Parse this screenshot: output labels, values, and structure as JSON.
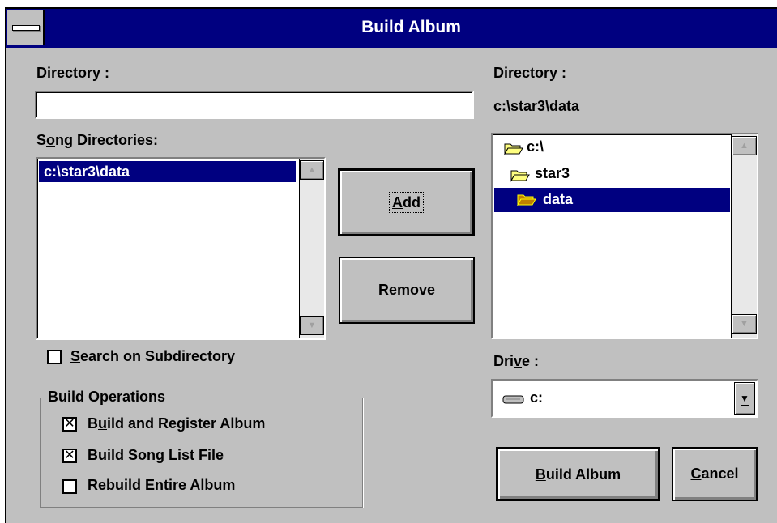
{
  "window": {
    "title": "Build Album"
  },
  "left": {
    "directory_label_pre": "D",
    "directory_label_u": "i",
    "directory_label_post": "rectory  :",
    "directory_value": "",
    "song_dirs_label_pre": "S",
    "song_dirs_label_u": "o",
    "song_dirs_label_post": "ng Directories:",
    "song_dirs": [
      "c:\\star3\\data"
    ],
    "search_sub_u": "S",
    "search_sub_post": "earch on Subdirectory",
    "search_sub_checked": false
  },
  "buttons": {
    "add_u": "A",
    "add_post": "dd",
    "remove_u": "R",
    "remove_post": "emove",
    "build_u": "B",
    "build_post": "uild Album",
    "cancel_u": "C",
    "cancel_post": "ancel"
  },
  "build_ops": {
    "title": "Build Operations",
    "items": [
      {
        "pre": "B",
        "u": "u",
        "post": "ild and Register Album",
        "checked": true,
        "mark": "✕"
      },
      {
        "pre": "Build Song ",
        "u": "L",
        "post": "ist File",
        "checked": true,
        "mark": "✕"
      },
      {
        "pre": "Rebuild ",
        "u": "E",
        "post": "ntire Album",
        "checked": false,
        "mark": ""
      }
    ]
  },
  "right": {
    "directory_label_u": "D",
    "directory_label_post": "irectory :",
    "current_dir": "c:\\star3\\data",
    "tree": [
      {
        "label": "c:\\",
        "selected": false,
        "icon": "folder-open-icon"
      },
      {
        "label": "star3",
        "selected": false,
        "icon": "folder-open-icon"
      },
      {
        "label": "data",
        "selected": true,
        "icon": "folder-selected-icon"
      }
    ],
    "drive_label_pre": "Dri",
    "drive_label_u": "v",
    "drive_label_post": "e :",
    "drive_value": "c:"
  },
  "icons": {
    "up": "▲",
    "down": "▼",
    "dropdown": "▼"
  }
}
